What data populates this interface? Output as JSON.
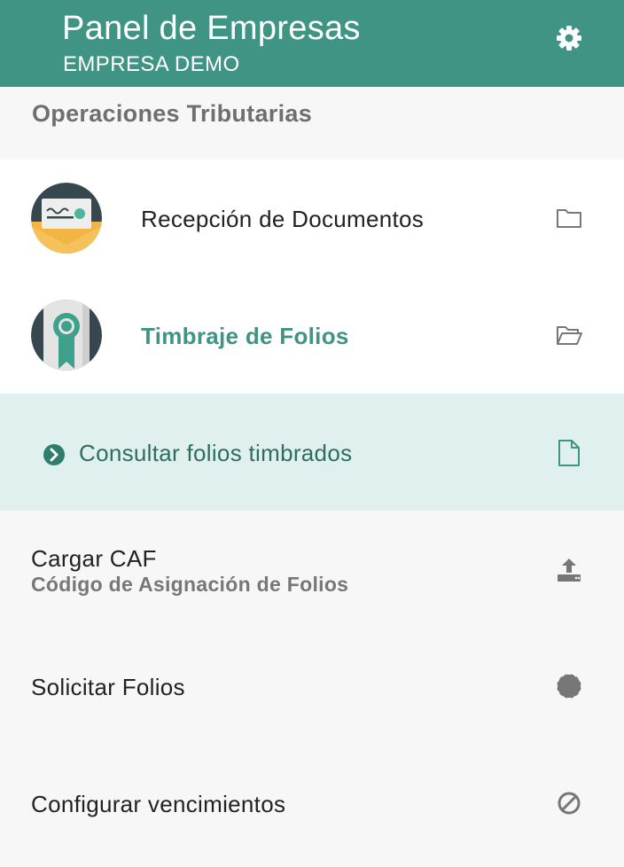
{
  "header": {
    "title": "Panel de Empresas",
    "subtitle": "EMPRESA DEMO",
    "settings_icon": "gear-icon",
    "background_color": "#409484"
  },
  "section": {
    "title": "Operaciones Tributarias"
  },
  "menu": [
    {
      "label": "Recepción de Documentos",
      "avatar": "envelope-letter",
      "icon": "folder-icon",
      "active": false
    },
    {
      "label": "Timbraje de Folios",
      "avatar": "certificate-ribbon",
      "icon": "folder-open-icon",
      "active": true
    }
  ],
  "submenu": {
    "selected": {
      "label": "Consultar folios timbrados",
      "icon": "file-icon",
      "bullet_icon": "chevron-circle-right-icon"
    },
    "items": [
      {
        "label": "Cargar CAF",
        "sublabel": "Código de Asignación de Folios",
        "icon": "upload-icon"
      },
      {
        "label": "Solicitar Folios",
        "icon": "certificate-badge-icon"
      },
      {
        "label": "Configurar vencimientos",
        "icon": "ban-icon"
      }
    ]
  },
  "colors": {
    "accent": "#409484",
    "selected_background": "#e0f0ee",
    "icon_grey": "#777777"
  }
}
